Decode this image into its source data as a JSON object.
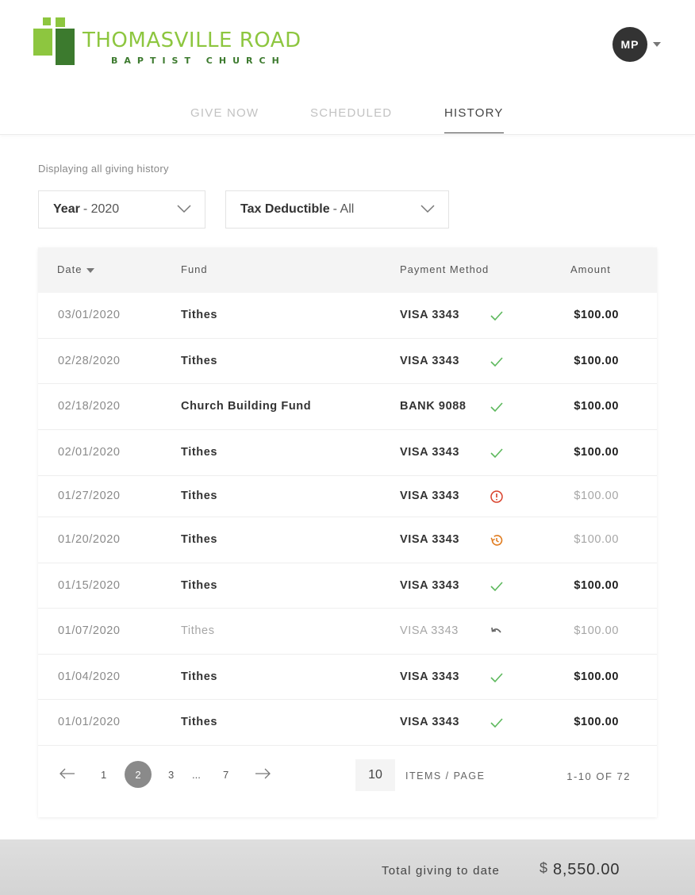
{
  "brand": {
    "name": "THOMASVILLE ROAD",
    "sub": "BAPTIST CHURCH",
    "colors": {
      "light_green": "#8dc63f",
      "dark_green": "#3c7a2e"
    }
  },
  "user": {
    "initials": "MP"
  },
  "tabs": [
    {
      "label": "GIVE NOW",
      "active": false
    },
    {
      "label": "SCHEDULED",
      "active": false
    },
    {
      "label": "HISTORY",
      "active": true
    }
  ],
  "subtitle": "Displaying all giving history",
  "filters": {
    "year": {
      "label": "Year",
      "value": "- 2020"
    },
    "tax": {
      "label": "Tax Deductible",
      "value": "- All"
    }
  },
  "table": {
    "headers": {
      "date": "Date",
      "fund": "Fund",
      "payment": "Payment Method",
      "amount": "Amount"
    },
    "rows": [
      {
        "date": "03/01/2020",
        "fund": "Tithes",
        "payment": "VISA 3343",
        "status": "check-icon",
        "amount": "$100.00",
        "amount_dim": false,
        "muted": false
      },
      {
        "date": "02/28/2020",
        "fund": "Tithes",
        "payment": "VISA 3343",
        "status": "check-icon",
        "amount": "$100.00",
        "amount_dim": false,
        "muted": false
      },
      {
        "date": "02/18/2020",
        "fund": "Church Building Fund",
        "payment": "BANK 9088",
        "status": "check-icon",
        "amount": "$100.00",
        "amount_dim": false,
        "muted": false
      },
      {
        "date": "02/01/2020",
        "fund": "Tithes",
        "payment": "VISA 3343",
        "status": "check-icon",
        "amount": "$100.00",
        "amount_dim": false,
        "muted": false
      },
      {
        "date": "01/27/2020",
        "fund": "Tithes",
        "payment": "VISA 3343",
        "status": "alert-icon",
        "amount": "$100.00",
        "amount_dim": true,
        "muted": false
      },
      {
        "date": "01/20/2020",
        "fund": "Tithes",
        "payment": "VISA 3343",
        "status": "pending-history-icon",
        "amount": "$100.00",
        "amount_dim": true,
        "muted": false
      },
      {
        "date": "01/15/2020",
        "fund": "Tithes",
        "payment": "VISA 3343",
        "status": "check-icon",
        "amount": "$100.00",
        "amount_dim": false,
        "muted": false
      },
      {
        "date": "01/07/2020",
        "fund": "Tithes",
        "payment": "VISA 3343",
        "status": "refund-icon",
        "amount": "$100.00",
        "amount_dim": true,
        "muted": true
      },
      {
        "date": "01/04/2020",
        "fund": "Tithes",
        "payment": "VISA 3343",
        "status": "check-icon",
        "amount": "$100.00",
        "amount_dim": false,
        "muted": false
      },
      {
        "date": "01/01/2020",
        "fund": "Tithes",
        "payment": "VISA 3343",
        "status": "check-icon",
        "amount": "$100.00",
        "amount_dim": false,
        "muted": false
      }
    ]
  },
  "pagination": {
    "pages": [
      "1",
      "2",
      "3",
      "...",
      "7"
    ],
    "current": "2",
    "per_page": "10",
    "per_page_label": "ITEMS / PAGE",
    "range": "1-10 OF 72"
  },
  "footer": {
    "label": "Total giving to date",
    "currency": "$",
    "total": "8,550.00"
  },
  "status_colors": {
    "check": "#5cb85c",
    "alert": "#d9412b",
    "pending": "#e07b1e",
    "refund": "#666666"
  }
}
